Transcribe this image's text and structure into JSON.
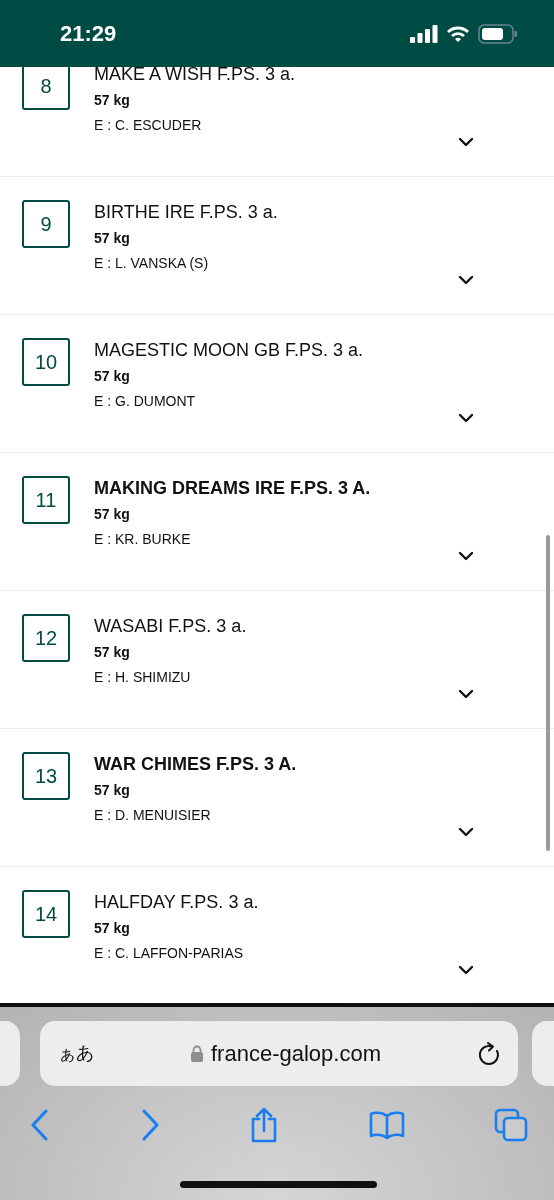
{
  "status_bar": {
    "time": "21:29"
  },
  "runners": [
    {
      "number": "8",
      "name": "MAKE A WISH F.PS. 3 a.",
      "bold": false,
      "weight": "57 kg",
      "trainer": "E : C. ESCUDER"
    },
    {
      "number": "9",
      "name": "BIRTHE IRE F.PS. 3 a.",
      "bold": false,
      "weight": "57 kg",
      "trainer": "E : L. VANSKA (S)"
    },
    {
      "number": "10",
      "name": "MAGESTIC MOON GB F.PS. 3 a.",
      "bold": false,
      "weight": "57 kg",
      "trainer": "E : G. DUMONT"
    },
    {
      "number": "11",
      "name": "MAKING DREAMS IRE F.PS. 3 A.",
      "bold": true,
      "weight": "57 kg",
      "trainer": "E : KR. BURKE"
    },
    {
      "number": "12",
      "name": "WASABI F.PS. 3 a.",
      "bold": false,
      "weight": "57 kg",
      "trainer": "E : H. SHIMIZU"
    },
    {
      "number": "13",
      "name": "WAR CHIMES F.PS. 3 A.",
      "bold": true,
      "weight": "57 kg",
      "trainer": "E : D. MENUISIER"
    },
    {
      "number": "14",
      "name": "HALFDAY F.PS. 3 a.",
      "bold": false,
      "weight": "57 kg",
      "trainer": "E : C. LAFFON-PARIAS"
    }
  ],
  "browser": {
    "text_size": "ぁあ",
    "url": "france-galop.com"
  }
}
